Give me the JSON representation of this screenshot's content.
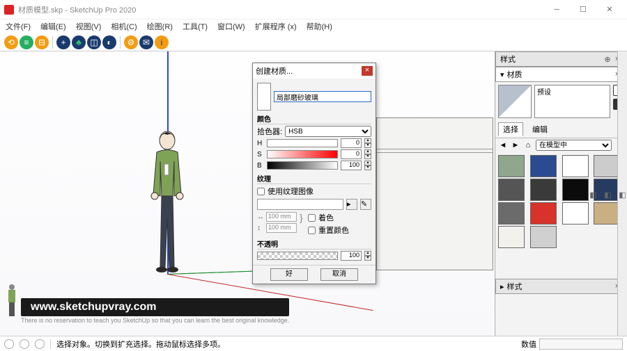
{
  "title": "材质模型.skp - SketchUp Pro 2020",
  "menus": [
    "文件(F)",
    "编辑(E)",
    "视图(V)",
    "相机(C)",
    "绘图(R)",
    "工具(T)",
    "窗口(W)",
    "扩展程序 (x)",
    "帮助(H)"
  ],
  "logo": {
    "url": "www.sketchupvray.com",
    "sub": "There is no reservation to teach you SketchUp so that you can learn the best original knowledge."
  },
  "status": {
    "text": "选择对象。切换到扩充选择。拖动鼠标选择多项。",
    "value_label": "数值"
  },
  "panels": {
    "tray_title": "样式",
    "material_title": "材质",
    "preset_label": "预设",
    "tab_select": "选择",
    "tab_edit": "编辑",
    "model_dropdown": "在模型中",
    "styles_title": "样式",
    "swatches": [
      "#8fa78d",
      "#2c4a8f",
      "#ffffff",
      "#cccccc",
      "#555555",
      "#3a3a3a",
      "#0b0b0b",
      "#273a5f",
      "#6b6b6b",
      "#d8332a",
      "#ffffff",
      "#c9b083",
      "#f2f1ed",
      "#d0d0d0"
    ]
  },
  "dialog": {
    "title": "创建材质...",
    "name_value": "局部磨砂玻璃",
    "section_color": "颜色",
    "picker_label": "拾色器:",
    "picker_value": "HSB",
    "h_label": "H",
    "h_value": "0",
    "s_label": "S",
    "s_value": "0",
    "b_label": "B",
    "b_value": "100",
    "section_texture": "纹理",
    "use_texture": "使用纹理图像",
    "width": "100 mm",
    "height": "100 mm",
    "colorize": "着色",
    "reset_color": "重置颜色",
    "section_opacity": "不透明",
    "opacity_value": "100",
    "ok": "好",
    "cancel": "取消"
  }
}
